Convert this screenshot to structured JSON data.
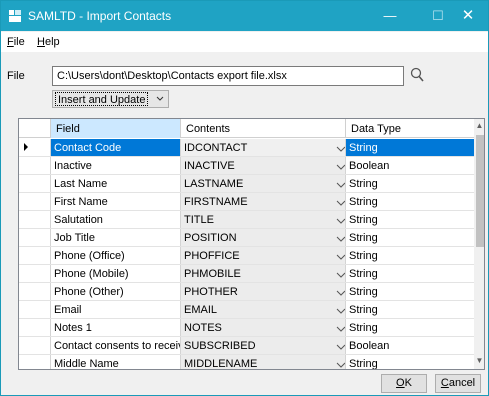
{
  "titlebar": {
    "title": "SAMLTD - Import Contacts",
    "app_icon": "app-icon",
    "minimize_label": "—",
    "maximize_label": "☐",
    "close_label": "✕"
  },
  "menu": {
    "file_key": "F",
    "file_rest": "ile",
    "help_key": "H",
    "help_rest": "elp"
  },
  "file": {
    "label": "File",
    "path": "C:\\Users\\dont\\Desktop\\Contacts export file.xlsx",
    "browse_icon": "magnifier-icon"
  },
  "mode": {
    "selected": "Insert and Update"
  },
  "grid": {
    "headers": {
      "field": "Field",
      "contents": "Contents",
      "data_type": "Data Type"
    },
    "rows": [
      {
        "field": "Contact Code",
        "contents": "IDCONTACT",
        "type": "String"
      },
      {
        "field": "Inactive",
        "contents": "INACTIVE",
        "type": "Boolean"
      },
      {
        "field": "Last Name",
        "contents": "LASTNAME",
        "type": "String"
      },
      {
        "field": "First Name",
        "contents": "FIRSTNAME",
        "type": "String"
      },
      {
        "field": "Salutation",
        "contents": "TITLE",
        "type": "String"
      },
      {
        "field": "Job Title",
        "contents": "POSITION",
        "type": "String"
      },
      {
        "field": "Phone (Office)",
        "contents": "PHOFFICE",
        "type": "String"
      },
      {
        "field": "Phone (Mobile)",
        "contents": "PHMOBILE",
        "type": "String"
      },
      {
        "field": "Phone (Other)",
        "contents": "PHOTHER",
        "type": "String"
      },
      {
        "field": "Email",
        "contents": "EMAIL",
        "type": "String"
      },
      {
        "field": "Notes 1",
        "contents": "NOTES",
        "type": "String"
      },
      {
        "field": "Contact consents to receive e...",
        "contents": "SUBSCRIBED",
        "type": "Boolean"
      },
      {
        "field": "Middle Name",
        "contents": "MIDDLENAME",
        "type": "String"
      }
    ]
  },
  "buttons": {
    "ok_key": "O",
    "ok_rest": "K",
    "cancel_key": "C",
    "cancel_rest": "ancel"
  },
  "colors": {
    "titlebar": "#1fa3c4",
    "selection": "#0078d7",
    "header_selected": "#cce8ff"
  }
}
